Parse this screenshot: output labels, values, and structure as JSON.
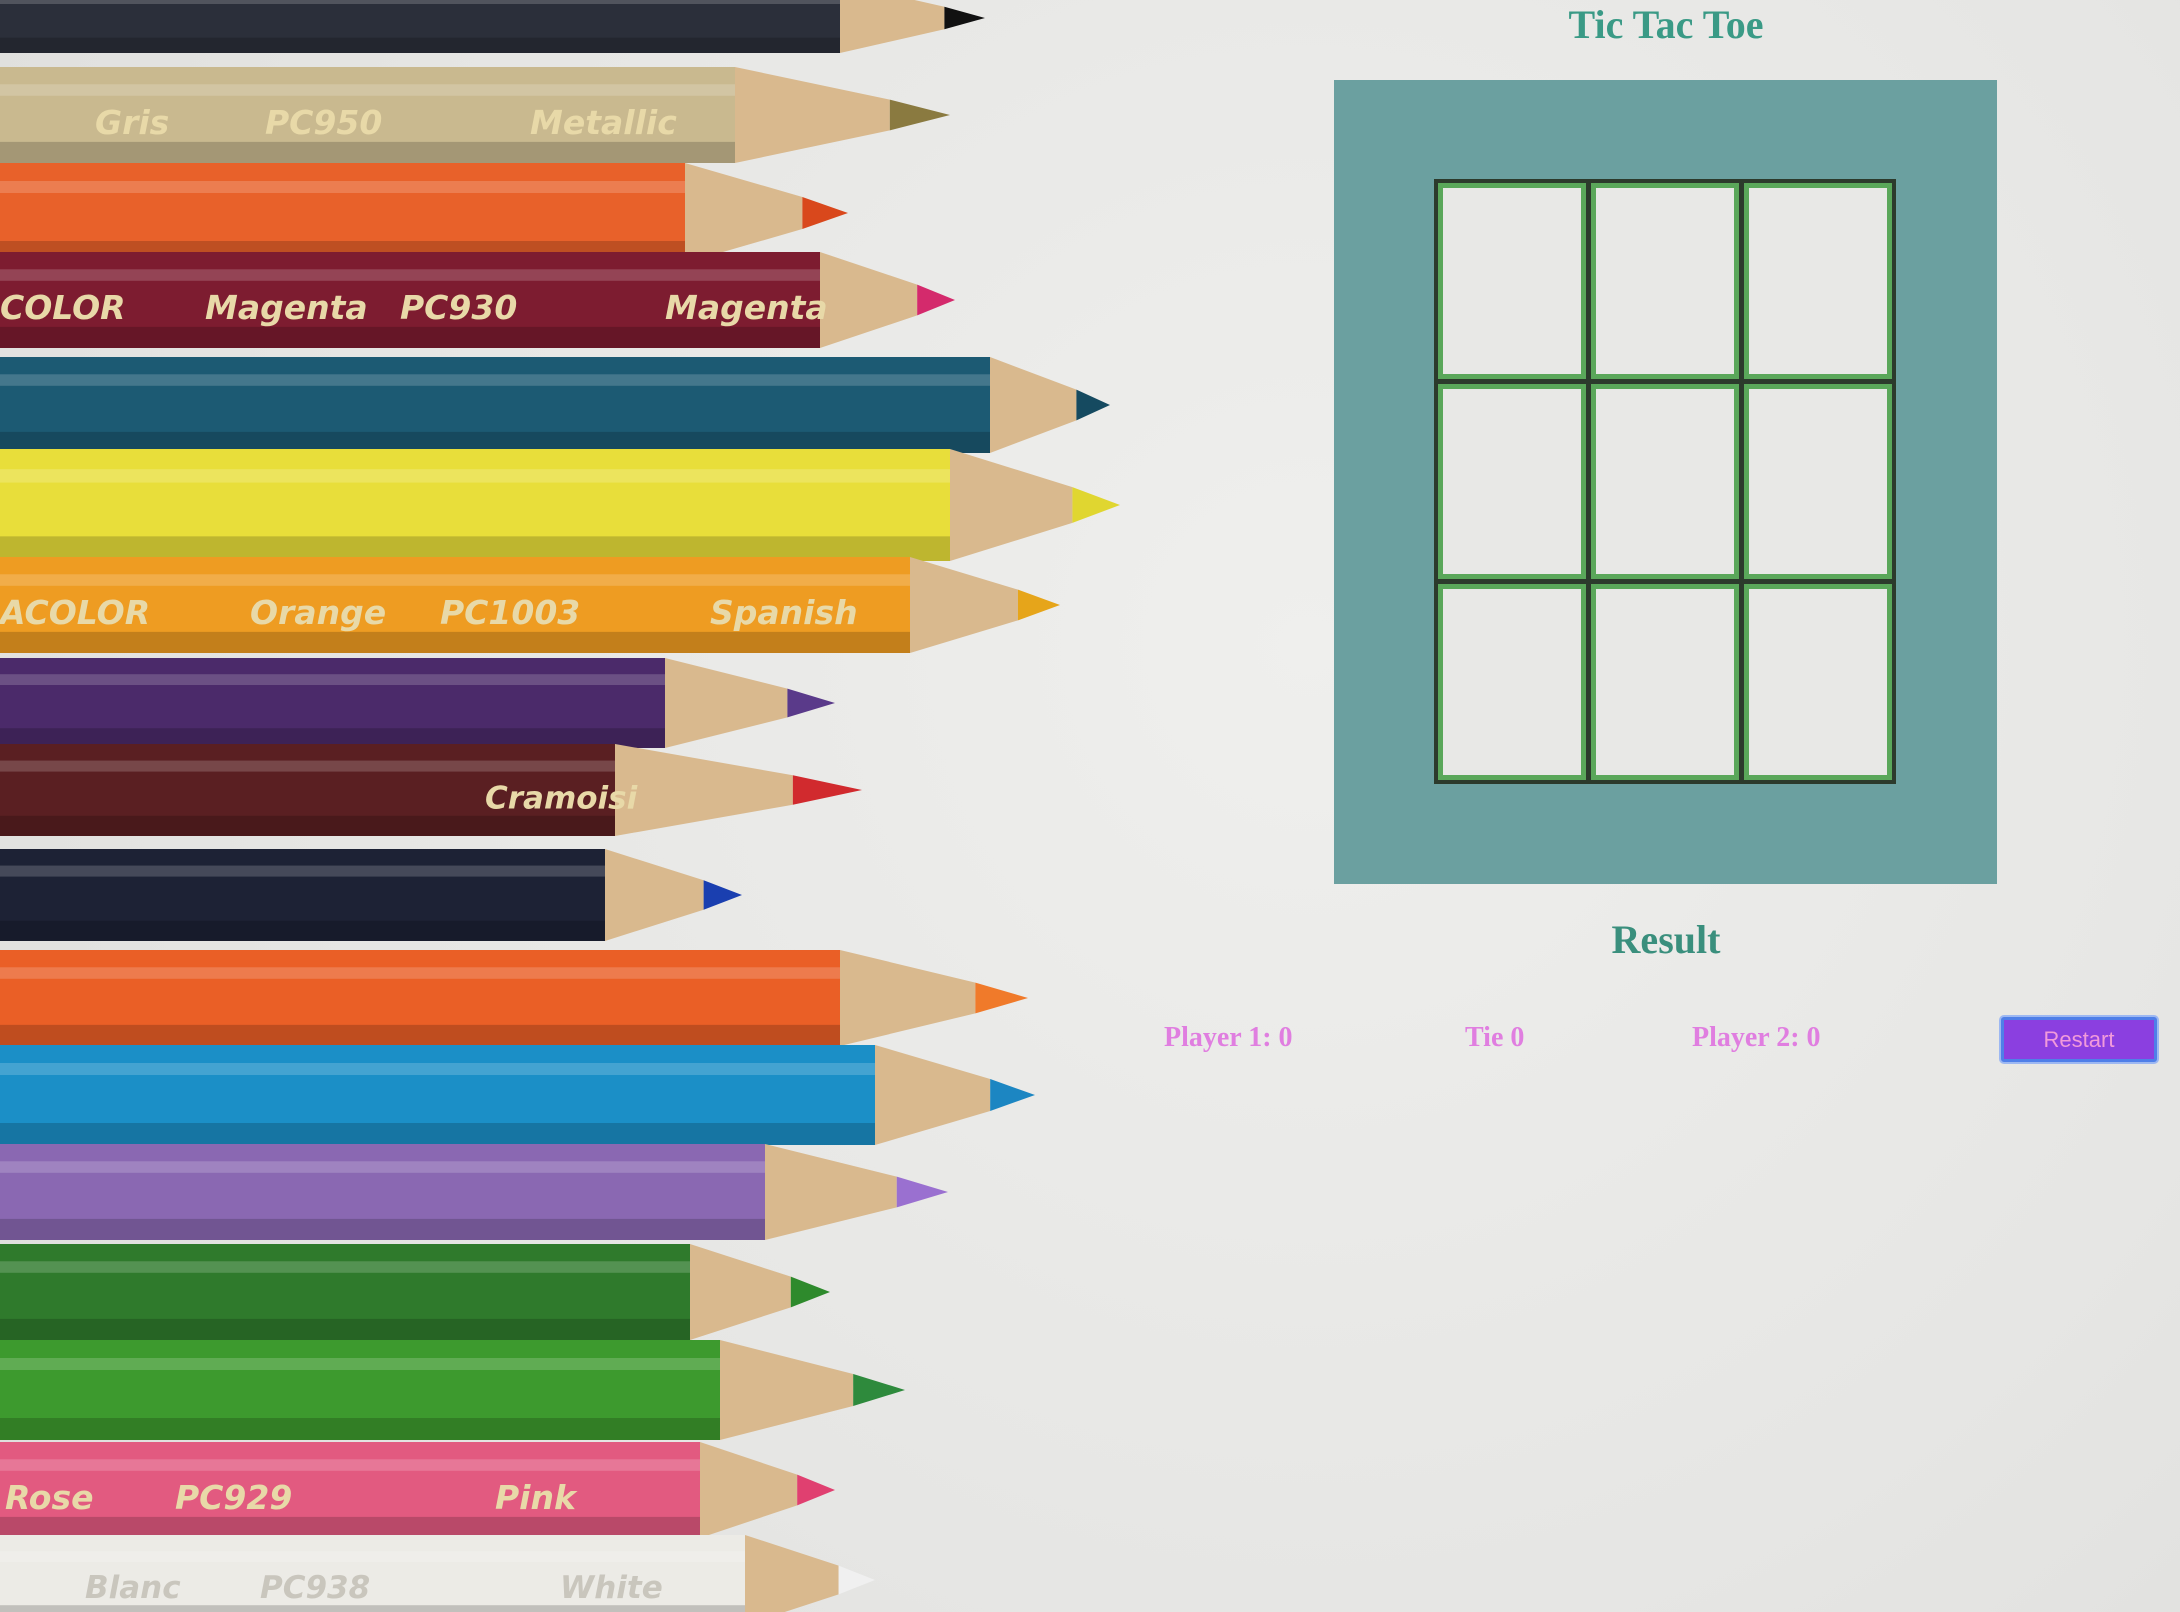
{
  "title": "Tic Tac Toe",
  "board": {
    "cells": [
      "",
      "",
      "",
      "",
      "",
      "",
      "",
      "",
      ""
    ]
  },
  "result": {
    "heading": "Result",
    "player1_label": "Player 1: 0",
    "tie_label": "Tie 0",
    "player2_label": "Player 2: 0"
  },
  "controls": {
    "restart_label": "Restart"
  },
  "background_pencils": [
    {
      "color": "#2b2f3a",
      "tip": "#111111",
      "labels": []
    },
    {
      "color": "#c9b98f",
      "tip": "#8a7a40",
      "labels": [
        "Gris",
        "PC950",
        "Metallic"
      ]
    },
    {
      "color": "#e8612a",
      "tip": "#d9481c",
      "labels": []
    },
    {
      "color": "#7d1c30",
      "tip": "#d42a6c",
      "labels": [
        "COLOR",
        "Magenta",
        "PC930",
        "Magenta"
      ]
    },
    {
      "color": "#1c5a73",
      "tip": "#154a60",
      "labels": []
    },
    {
      "color": "#e8de3a",
      "tip": "#e0d630",
      "labels": []
    },
    {
      "color": "#ee9c22",
      "tip": "#e6a51a",
      "labels": [
        "ACOLOR",
        "Orange",
        "PC1003",
        "Spanish"
      ]
    },
    {
      "color": "#4b2a6a",
      "tip": "#5a3a8a",
      "labels": []
    },
    {
      "color": "#5a1f22",
      "tip": "#d12a2e",
      "labels": [
        "Cramoisi"
      ]
    },
    {
      "color": "#1d2235",
      "tip": "#1a3fb0",
      "labels": []
    },
    {
      "color": "#ea5f26",
      "tip": "#f07a2a",
      "labels": []
    },
    {
      "color": "#1b8fc7",
      "tip": "#1c86c2",
      "labels": []
    },
    {
      "color": "#8a68b2",
      "tip": "#9a70d0",
      "labels": []
    },
    {
      "color": "#2f7a2c",
      "tip": "#2e8a2c",
      "labels": []
    },
    {
      "color": "#3d9a2e",
      "tip": "#2e8a3c",
      "labels": []
    },
    {
      "color": "#e25a80",
      "tip": "#e04070",
      "labels": [
        "Rose",
        "PC929",
        "Pink"
      ]
    },
    {
      "color": "#ecebe6",
      "tip": "#f0f0f0",
      "labels": [
        "Blanc",
        "PC938",
        "White"
      ]
    }
  ]
}
